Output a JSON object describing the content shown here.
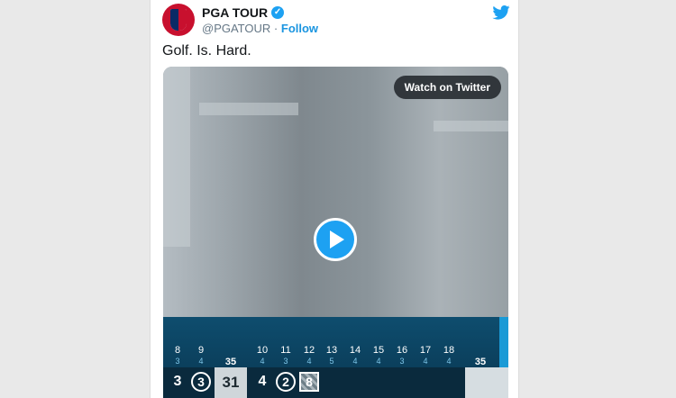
{
  "tweet": {
    "account_name": "PGA TOUR",
    "handle": "@PGATOUR",
    "separator": "·",
    "follow_label": "Follow",
    "text": "Golf. Is. Hard."
  },
  "video": {
    "watch_label": "Watch on Twitter"
  },
  "scoreboard": {
    "holes": [
      {
        "num": "8",
        "par": "3"
      },
      {
        "num": "9",
        "par": "4"
      },
      {
        "num": "10",
        "par": "4"
      },
      {
        "num": "11",
        "par": "3"
      },
      {
        "num": "12",
        "par": "4"
      },
      {
        "num": "13",
        "par": "5"
      },
      {
        "num": "14",
        "par": "4"
      },
      {
        "num": "15",
        "par": "4"
      },
      {
        "num": "16",
        "par": "3"
      },
      {
        "num": "17",
        "par": "4"
      },
      {
        "num": "18",
        "par": "4"
      }
    ],
    "out_total": "35",
    "in_total": "35",
    "scores": [
      "3",
      "3",
      "31",
      "4",
      "2",
      "8"
    ]
  },
  "colors": {
    "twitter_blue": "#1da1f2",
    "brand_red": "#c8102e",
    "scoreboard_blue": "#0e4d6e"
  }
}
